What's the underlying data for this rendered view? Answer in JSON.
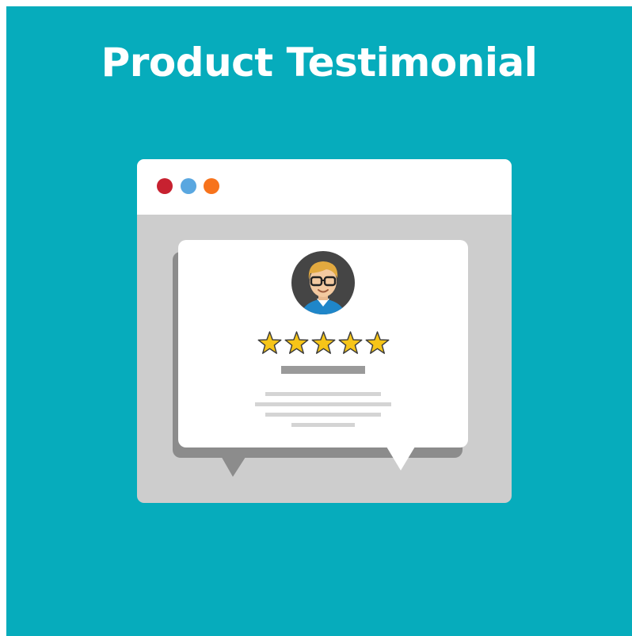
{
  "title": "Product Testimonial",
  "colors": {
    "background": "#06acbc",
    "window_frame": "#cdcdcd",
    "window_bar": "#ffffff",
    "card": "#ffffff",
    "card_shadow": "#8c8c8c",
    "dot_red": "#c72130",
    "dot_blue": "#5aa7e0",
    "dot_orange": "#f7731c",
    "star": "#f6c518",
    "text_bar": "#9a9a9a",
    "text_lines": "#d4d4d4"
  },
  "rating": {
    "value": 5,
    "max": 5
  },
  "icons": [
    "window-dot-red-icon",
    "window-dot-blue-icon",
    "window-dot-orange-icon",
    "user-avatar-icon",
    "star-icon"
  ]
}
